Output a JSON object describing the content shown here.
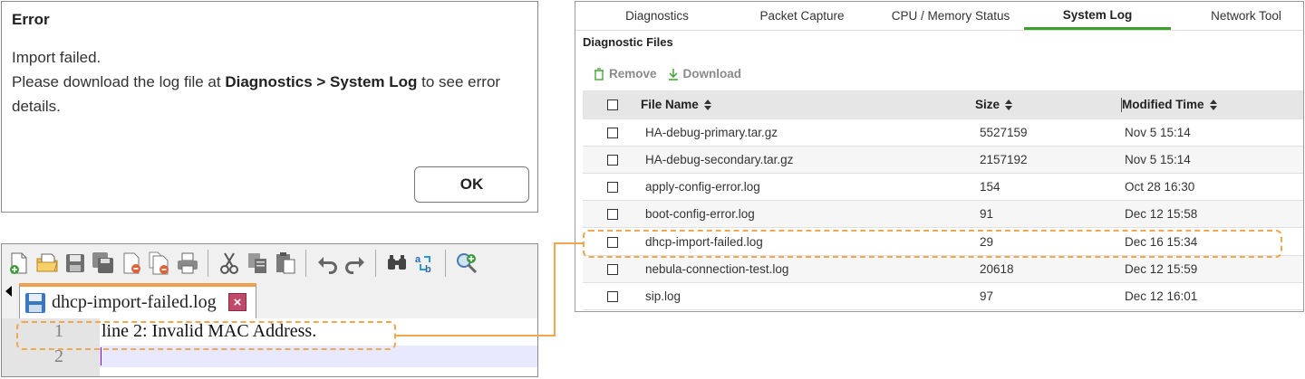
{
  "dialog": {
    "title": "Error",
    "line1": "Import failed.",
    "line2_prefix": "Please download the log file at ",
    "line2_bold": "Diagnostics > System Log",
    "line2_suffix": " to see error details.",
    "ok_label": "OK"
  },
  "editor": {
    "toolbar_icons": [
      "new-file-icon",
      "open-file-icon",
      "save-icon",
      "save-all-icon",
      "close-icon",
      "close-all-icon",
      "print-icon",
      "cut-icon",
      "copy-icon",
      "paste-icon",
      "undo-icon",
      "redo-icon",
      "find-icon",
      "replace-icon",
      "zoom-in-icon"
    ],
    "tab_label": "dhcp-import-failed.log",
    "lines": [
      {
        "number": "1",
        "text": "line 2: Invalid MAC Address."
      },
      {
        "number": "2",
        "text": ""
      }
    ]
  },
  "web": {
    "tabs": [
      {
        "label": "Diagnostics",
        "active": false
      },
      {
        "label": "Packet Capture",
        "active": false
      },
      {
        "label": "CPU / Memory Status",
        "active": false
      },
      {
        "label": "System Log",
        "active": true
      },
      {
        "label": "Network Tool",
        "active": false
      }
    ],
    "section_title": "Diagnostic Files",
    "actions": {
      "remove": "Remove",
      "download": "Download"
    },
    "columns": {
      "name": "File Name",
      "size": "Size",
      "time": "Modified Time"
    },
    "files": [
      {
        "name": "HA-debug-primary.tar.gz",
        "size": "5527159",
        "time": "Nov 5 15:14"
      },
      {
        "name": "HA-debug-secondary.tar.gz",
        "size": "2157192",
        "time": "Nov 5 15:14"
      },
      {
        "name": "apply-config-error.log",
        "size": "154",
        "time": "Oct 28 16:30"
      },
      {
        "name": "boot-config-error.log",
        "size": "91",
        "time": "Dec 12 15:58"
      },
      {
        "name": "dhcp-import-failed.log",
        "size": "29",
        "time": "Dec 16 15:34"
      },
      {
        "name": "nebula-connection-test.log",
        "size": "20618",
        "time": "Dec 12 15:59"
      },
      {
        "name": "sip.log",
        "size": "97",
        "time": "Dec 12 16:01"
      }
    ]
  },
  "colors": {
    "highlight": "#f0a850",
    "active_tab": "#3aa02a",
    "tab_accent": "#f0a04a"
  }
}
